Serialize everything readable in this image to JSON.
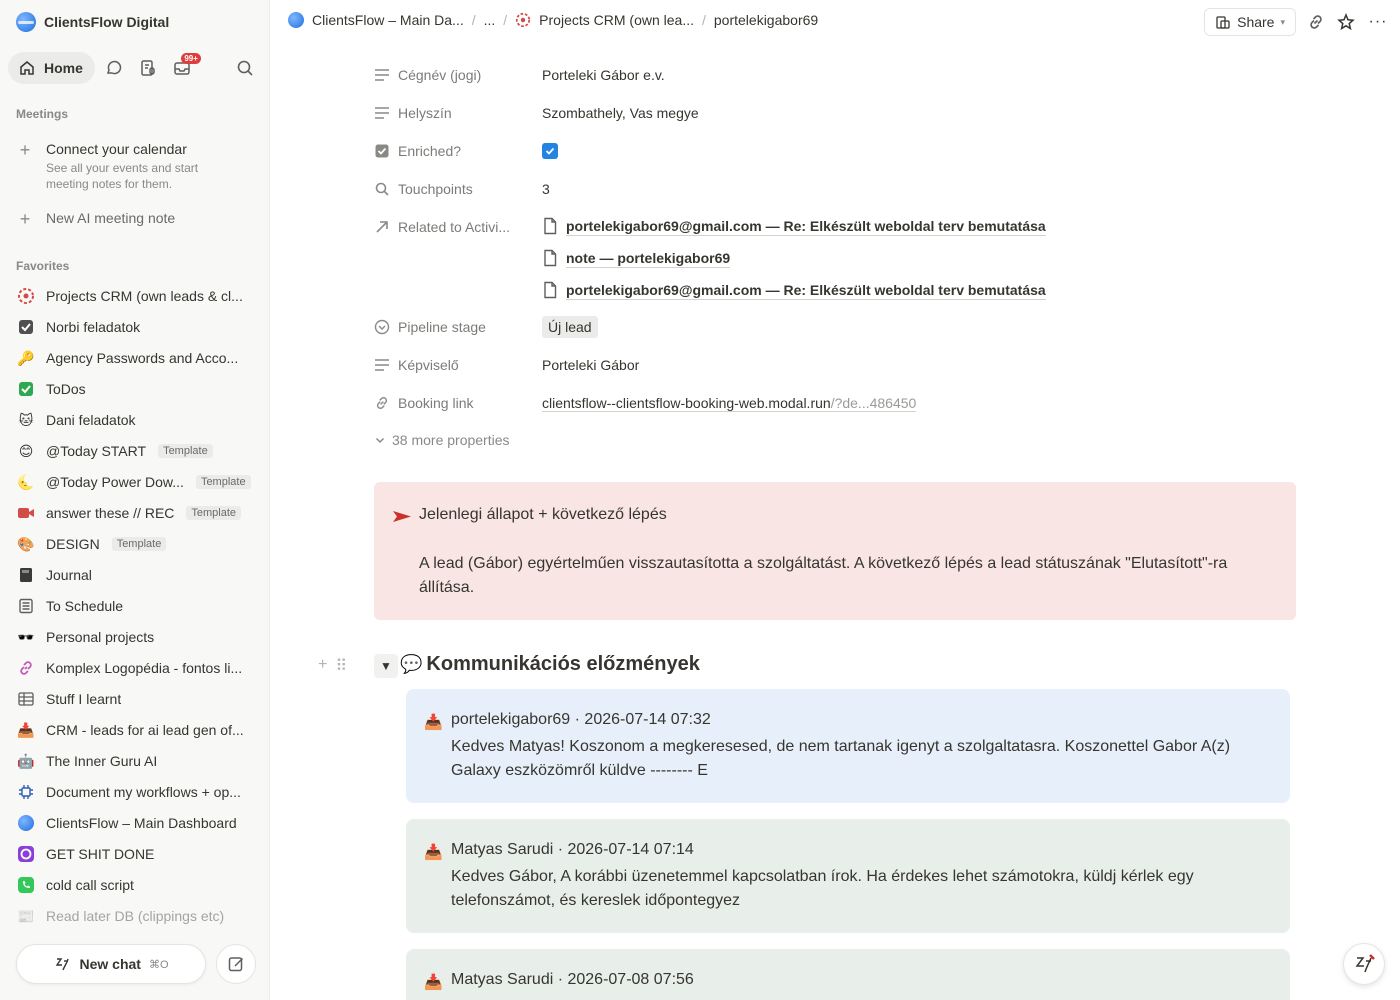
{
  "workspace": {
    "name": "ClientsFlow Digital"
  },
  "nav": {
    "home_label": "Home",
    "inbox_badge": "99+"
  },
  "meetings": {
    "section_title": "Meetings",
    "connect_title": "Connect your calendar",
    "connect_desc": "See all your events and start meeting notes for them.",
    "new_note": "New AI meeting note"
  },
  "favorites": {
    "section_title": "Favorites",
    "items": [
      {
        "label": "Projects CRM (own leads & cl...",
        "icon": "crm-target-icon",
        "template": ""
      },
      {
        "label": "Norbi feladatok",
        "icon": "checkbox-icon",
        "template": ""
      },
      {
        "label": "Agency Passwords and Acco...",
        "icon": "key-icon",
        "template": ""
      },
      {
        "label": "ToDos",
        "icon": "green-check-icon",
        "template": ""
      },
      {
        "label": "Dani feladatok",
        "icon": "cat-icon",
        "template": ""
      },
      {
        "label": "@Today START",
        "icon": "smile-icon",
        "template": "Template"
      },
      {
        "label": "@Today Power Dow...",
        "icon": "moon-icon",
        "template": "Template"
      },
      {
        "label": "answer these // REC",
        "icon": "video-camera-icon",
        "template": "Template"
      },
      {
        "label": "DESIGN",
        "icon": "palette-icon",
        "template": "Template"
      },
      {
        "label": "Journal",
        "icon": "notebook-icon",
        "template": ""
      },
      {
        "label": "To Schedule",
        "icon": "list-icon",
        "template": ""
      },
      {
        "label": "Personal projects",
        "icon": "sunglasses-icon",
        "template": ""
      },
      {
        "label": "Komplex Logopédia - fontos li...",
        "icon": "link-icon",
        "template": ""
      },
      {
        "label": "Stuff I learnt",
        "icon": "table-icon",
        "template": ""
      },
      {
        "label": "CRM - leads for ai lead gen of...",
        "icon": "inbox-tray-icon",
        "template": ""
      },
      {
        "label": "The Inner Guru AI",
        "icon": "robot-icon",
        "template": ""
      },
      {
        "label": "Document my workflows + op...",
        "icon": "chip-icon",
        "template": ""
      },
      {
        "label": "ClientsFlow – Main Dashboard",
        "icon": "globe-icon",
        "template": ""
      },
      {
        "label": "GET SHIT DONE",
        "icon": "purple-circle-icon",
        "template": ""
      },
      {
        "label": "cold call script",
        "icon": "phone-icon",
        "template": ""
      },
      {
        "label": "Read later DB (clippings etc)",
        "icon": "newspaper-icon",
        "template": ""
      }
    ]
  },
  "chat": {
    "new_chat": "New chat",
    "shortcut": "⌘O"
  },
  "breadcrumbs": {
    "c1": "ClientsFlow – Main Da...",
    "c2": "...",
    "c3": "Projects CRM (own lea...",
    "c4": "portelekigabor69"
  },
  "topbar": {
    "share": "Share"
  },
  "properties": {
    "company_name": "Cégnév (jogi)",
    "company_value": "Porteleki Gábor e.v.",
    "location_name": "Helyszín",
    "location_value": "Szombathely, Vas megye",
    "enriched_name": "Enriched?",
    "enriched_value": true,
    "touchpoints_name": "Touchpoints",
    "touchpoints_value": "3",
    "related_name": "Related to Activi...",
    "related_items": [
      "portelekigabor69@gmail.com — Re: Elkészült weboldal terv bemutatása",
      "note — portelekigabor69",
      "portelekigabor69@gmail.com — Re: Elkészült weboldal terv bemutatása"
    ],
    "pipeline_name": "Pipeline stage",
    "pipeline_value": "Új lead",
    "rep_name": "Képviselő",
    "rep_value": "Porteleki Gábor",
    "booking_name": "Booking link",
    "booking_main": "clientsflow--clientsflow-booking-web.modal.run",
    "booking_rest": "/?de...486450",
    "more": "38 more properties"
  },
  "callout": {
    "title": "Jelenlegi állapot + következő lépés",
    "body": "A lead (Gábor) egyértelműen visszautasította a szolgáltatást. A következő lépés a lead státuszának \"Elutasított\"-ra állítása."
  },
  "history": {
    "heading": "Kommunikációs előzmények",
    "messages": [
      {
        "header": "portelekigabor69 · 2026-07-14 07:32",
        "body": "Kedves Matyas! Koszonom a megkeresesed, de nem tartanak igenyt a szolgaltatasra. Koszonettel Gabor A(z) Galaxy eszközömről küldve -------- E",
        "color": "#e7f0fa"
      },
      {
        "header": "Matyas Sarudi · 2026-07-14 07:14",
        "body": "Kedves Gábor, A korábbi üzenetemmel kapcsolatban írok. Ha érdekes lehet számotokra, küldj kérlek egy telefonszámot, és kereslek időpontegyez",
        "color": "#e8efea"
      },
      {
        "header": "Matyas Sarudi · 2026-07-08 07:56",
        "body": "",
        "color": "#e8efea"
      }
    ]
  }
}
